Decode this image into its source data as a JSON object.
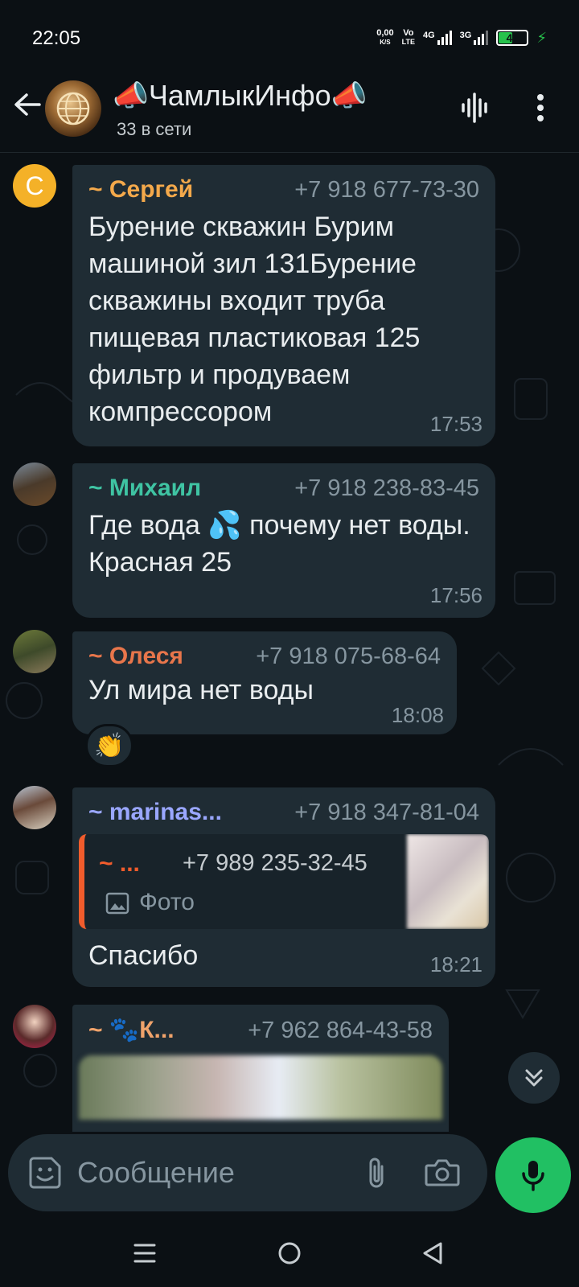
{
  "status_bar": {
    "time": "22:05",
    "net_speed_value": "0,00",
    "net_speed_unit": "K/S",
    "volte_top": "Vo",
    "volte_bottom": "LTE",
    "sim1_label": "4G",
    "sim2_label": "3G",
    "battery_level": "47",
    "battery_fraction": 0.47
  },
  "header": {
    "title": "📣ЧамлыкИнфо📣",
    "subtitle": "33 в сети"
  },
  "colors": {
    "bubble": "#1f2c34",
    "accent_green": "#21c063",
    "name_sergey": "#f4a94b",
    "name_mikhail": "#3fc4a3",
    "name_olesya": "#e8764b",
    "name_marina": "#9aa7ff",
    "name_k": "#f0a36b",
    "quote_bar": "#f15c2c"
  },
  "messages": [
    {
      "avatar_letter": "С",
      "name": "~ Сергей",
      "phone": "+7 918 677-73-30",
      "text": "Бурение скважин Бурим машиной зил 131Бурение скважины входит труба пищевая пластиковая 125 фильтр и продуваем компрессором",
      "time": "17:53"
    },
    {
      "name": "~ Михаил",
      "phone": "+7 918 238-83-45",
      "text": "Где вода 💦 почему нет воды. Красная 25",
      "time": "17:56"
    },
    {
      "name": "~ Олеся",
      "phone": "+7 918 075-68-64",
      "text": "Ул мира нет воды",
      "time": "18:08",
      "reaction": "👏"
    },
    {
      "name": "~ marinas...",
      "phone": "+7 918 347-81-04",
      "quote": {
        "name": "~ ...",
        "phone": "+7 989 235-32-45",
        "type": "Фото"
      },
      "text": "Спасибо",
      "time": "18:21"
    },
    {
      "name": "~ 🐾К...",
      "phone": "+7 962 864-43-58"
    }
  ],
  "composer": {
    "placeholder": "Сообщение"
  },
  "icons": {
    "back": "arrow-left-icon",
    "voice_chat": "voice-waveform-icon",
    "menu": "more-vertical-icon",
    "emoji": "sticker-icon",
    "attach": "paperclip-icon",
    "camera": "camera-icon",
    "mic": "microphone-icon",
    "scroll": "double-chevron-down-icon"
  }
}
